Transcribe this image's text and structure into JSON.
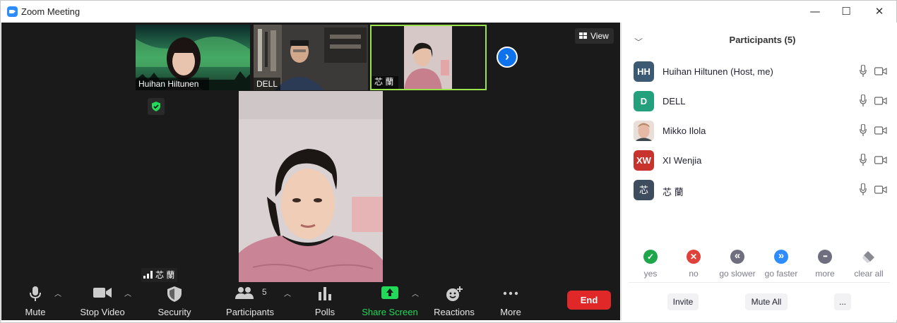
{
  "window": {
    "title": "Zoom Meeting",
    "minimize": "—",
    "maximize": "☐",
    "close": "✕"
  },
  "gallery": {
    "thumbnails": [
      {
        "name": "Huihan Hiltunen"
      },
      {
        "name": "DELL"
      },
      {
        "name": "芯 蘭"
      }
    ],
    "next_icon": "chevron-right-icon",
    "view_label": "View"
  },
  "main_video": {
    "speaker_label": "芯 蘭"
  },
  "toolbar": {
    "mute": "Mute",
    "stop_video": "Stop Video",
    "security": "Security",
    "participants": "Participants",
    "participants_count": "5",
    "polls": "Polls",
    "share_screen": "Share Screen",
    "reactions": "Reactions",
    "more": "More",
    "end": "End",
    "share_color": "#23d959",
    "end_color": "#e02828"
  },
  "panel": {
    "title": "Participants (5)",
    "participants": [
      {
        "initials": "HH",
        "name": "Huihan Hiltunen (Host, me)",
        "color": "#3d5a75"
      },
      {
        "initials": "D",
        "name": "DELL",
        "color": "#24a17c"
      },
      {
        "initials": "",
        "name": "Mikko Ilola",
        "color": "#d8b6a8"
      },
      {
        "initials": "XW",
        "name": "XI Wenjia",
        "color": "#c8342d"
      },
      {
        "initials": "芯",
        "name": "芯 蘭",
        "color": "#3d4d5e"
      }
    ],
    "feedback": [
      {
        "label": "yes",
        "glyph": "✓",
        "color": "#1fa64a"
      },
      {
        "label": "no",
        "glyph": "✕",
        "color": "#e0413a"
      },
      {
        "label": "go slower",
        "glyph": "«",
        "color": "#6e6e7e"
      },
      {
        "label": "go faster",
        "glyph": "»",
        "color": "#2d8cff"
      },
      {
        "label": "more",
        "glyph": "•••",
        "color": "#6e6e7e"
      },
      {
        "label": "clear all",
        "glyph": "",
        "color": "#bdbdc4"
      }
    ],
    "invite": "Invite",
    "mute_all": "Mute All",
    "more": "..."
  }
}
